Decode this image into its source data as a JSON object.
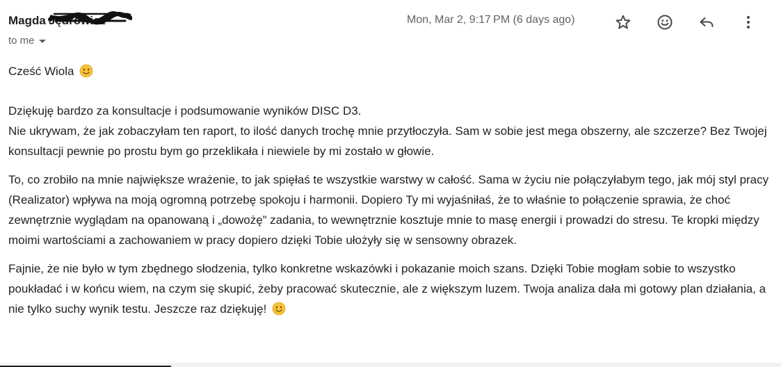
{
  "message": {
    "sender_first": "Magda",
    "sender_last": "Jędrowicz",
    "recipient": "to me",
    "date": "Mon, Mar 2, 9:17 PM (6 days ago)"
  },
  "actions": {
    "star_icon": "star-icon",
    "emoji_icon": "smiley-icon",
    "reply_icon": "reply-icon",
    "more_icon": "more-vert-icon"
  },
  "body": {
    "greeting": "Cześć Wiola",
    "p1_line1": "Dziękuję bardzo za konsultacje i podsumowanie wyników DISC D3.",
    "p1_line2": "Nie ukrywam, że jak zobaczyłam ten raport, to ilość danych trochę mnie przytłoczyła. Sam w sobie jest mega obszerny, ale szczerze? Bez Twojej konsultacji pewnie po prostu bym go przeklikała i niewiele by mi zostało w głowie.",
    "p2": "To, co zrobiło na mnie największe wrażenie, to jak spięłaś te wszystkie warstwy w całość. Sama w życiu nie połączyłabym tego, jak mój styl pracy (Realizator) wpływa na moją ogromną potrzebę spokoju i harmonii. Dopiero Ty mi wyjaśniłaś, że to właśnie to połączenie sprawia, że choć zewnętrznie wyglądam na opanowaną i „dowożę” zadania, to wewnętrznie kosztuje mnie to masę energii i prowadzi do stresu. Te kropki między moimi wartościami a zachowaniem w pracy dopiero dzięki Tobie ułożyły się w sensowny obrazek.",
    "p3": "Fajnie, że nie było w tym zbędnego słodzenia, tylko konkretne wskazówki i pokazanie moich szans. Dzięki Tobie mogłam sobie to wszystko poukładać i w końcu wiem, na czym się skupić, żeby pracować skutecznie, ale z większym luzem. Twoja analiza dała mi gotowy plan działania, a nie tylko suchy wynik testu. Jeszcze raz dziękuję!",
    "emoji_icon": "slightly-smiling-face-emoji"
  },
  "colors": {
    "text": "#222222",
    "meta": "#5f6368",
    "emoji": "#f6c33b"
  }
}
